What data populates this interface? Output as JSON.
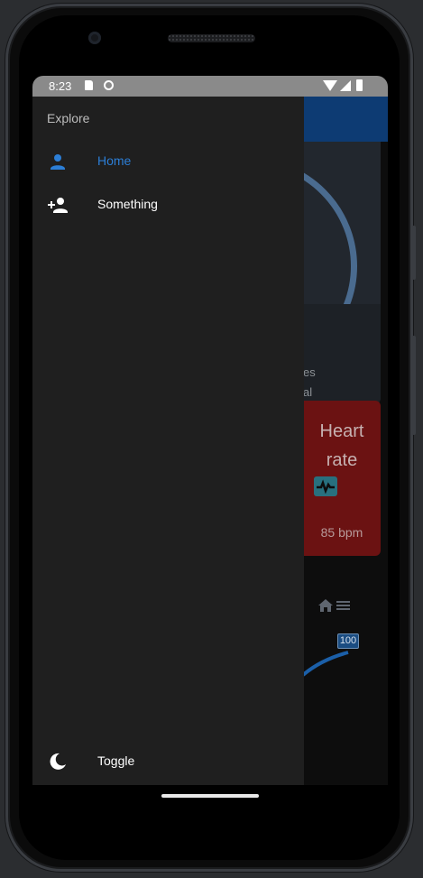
{
  "status_bar": {
    "time": "8:23"
  },
  "drawer": {
    "header": "Explore",
    "items": [
      {
        "label": "Home",
        "icon": "person-icon",
        "active": true
      },
      {
        "label": "Something",
        "icon": "person-add-icon",
        "active": false
      }
    ],
    "footer": {
      "label": "Toggle",
      "icon": "moon-icon"
    }
  },
  "background_app": {
    "card_text_1": "es",
    "card_text_2": "al",
    "heart_rate": {
      "title_line1": "Heart",
      "title_line2": "rate",
      "value": "85 bpm"
    },
    "gauge_badge": "100"
  },
  "colors": {
    "accent": "#2c7ed6",
    "drawer_bg": "#1f1f1f",
    "heart_card": "#6b1212"
  }
}
